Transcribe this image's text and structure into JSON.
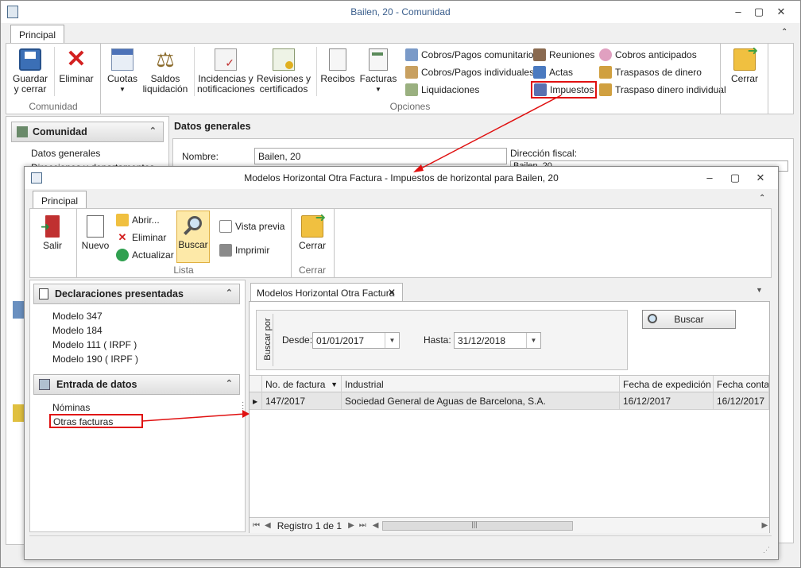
{
  "main_window": {
    "title": "Bailen, 20 - Comunidad",
    "tab": "Principal",
    "buttons": {
      "guardar": "Guardar\ny cerrar",
      "eliminar": "Eliminar",
      "cuotas": "Cuotas",
      "saldos": "Saldos\nliquidación",
      "incidencias": "Incidencias y\nnotificaciones",
      "revisiones": "Revisiones y\ncertificados",
      "recibos": "Recibos",
      "facturas": "Facturas",
      "cerrar": "Cerrar"
    },
    "small": {
      "cobros_com": "Cobros/Pagos comunitarios",
      "cobros_ind": "Cobros/Pagos individuales",
      "liquidaciones": "Liquidaciones",
      "reuniones": "Reuniones",
      "actas": "Actas",
      "impuestos": "Impuestos",
      "cobros_ant": "Cobros anticipados",
      "traspasos": "Traspasos de dinero",
      "traspaso_ind": "Traspaso dinero individual"
    },
    "groups": {
      "comunidad": "Comunidad",
      "opciones": "Opciones"
    },
    "nav_header": "Comunidad",
    "nav_items": [
      "Datos generales",
      "Direcciones y departamentos"
    ],
    "section_title": "Datos generales",
    "nombre_label": "Nombre:",
    "nombre_value": "Bailen, 20",
    "direccion_label": "Dirección fiscal:",
    "direccion_value": "Bailen, 20"
  },
  "dialog": {
    "title": "Modelos Horizontal Otra Factura - Impuestos de horizontal para Bailen, 20",
    "tab": "Principal",
    "buttons": {
      "salir": "Salir",
      "nuevo": "Nuevo",
      "abrir": "Abrir...",
      "eliminar": "Eliminar",
      "actualizar": "Actualizar",
      "buscar": "Buscar",
      "vista_previa": "Vista previa",
      "imprimir": "Imprimir",
      "cerrar": "Cerrar"
    },
    "groups": {
      "lista": "Lista",
      "cerrar": "Cerrar"
    },
    "panel1": {
      "title": "Declaraciones presentadas",
      "items": [
        "Modelo 347",
        "Modelo 184",
        "Modelo 111 ( IRPF )",
        "Modelo 190 ( IRPF )"
      ]
    },
    "panel2": {
      "title": "Entrada de datos",
      "items": [
        "Nóminas",
        "Otras facturas"
      ]
    },
    "doc_tab": "Modelos Horizontal Otra Factura",
    "search": {
      "group_label": "Buscar por",
      "desde_label": "Desde:",
      "desde_value": "01/01/2017",
      "hasta_label": "Hasta:",
      "hasta_value": "31/12/2018",
      "button": "Buscar"
    },
    "grid": {
      "columns": [
        "No. de factura",
        "Industrial",
        "Fecha de expedición",
        "Fecha contabl"
      ],
      "rows": [
        [
          "147/2017",
          "Sociedad General de Aguas de Barcelona, S.A.",
          "16/12/2017",
          "16/12/2017"
        ]
      ]
    },
    "nav": {
      "record": "Registro 1 de 1"
    }
  },
  "colors": {
    "highlight": "#e01010",
    "title_text": "#3a5e8c"
  }
}
